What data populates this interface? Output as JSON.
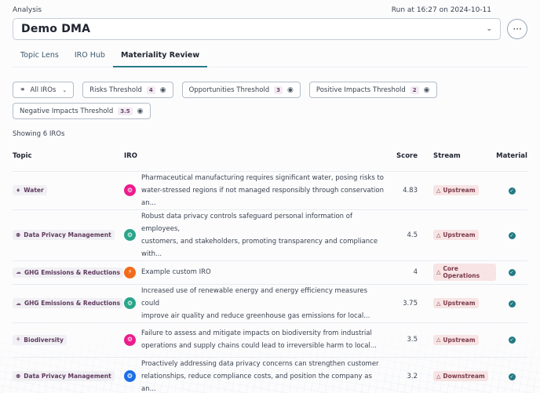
{
  "header": {
    "analysis_label": "Analysis",
    "run_at": "Run at 16:27 on 2024-10-11",
    "analysis_value": "Demo DMA",
    "more_icon": "ellipsis-icon"
  },
  "tabs": [
    {
      "label": "Topic Lens",
      "active": false
    },
    {
      "label": "IRO Hub",
      "active": false
    },
    {
      "label": "Materiality Review",
      "active": true
    }
  ],
  "filters": {
    "all_iros": {
      "label": "All IROs",
      "icon": "link-filter-icon"
    },
    "thresholds": [
      {
        "label": "Risks Threshold",
        "value": "4"
      },
      {
        "label": "Opportunities Threshold",
        "value": "3"
      },
      {
        "label": "Positive Impacts Threshold",
        "value": "2"
      },
      {
        "label": "Negative Impacts Threshold",
        "value": "3.5"
      }
    ]
  },
  "showing": "Showing 6 IROs",
  "table": {
    "columns": [
      "Topic",
      "IRO",
      "Score",
      "Stream",
      "Material"
    ],
    "rows": [
      {
        "topic": "Water",
        "topic_icon": "droplet-icon",
        "iro_type": "negative-impact",
        "iro_color": "#ec1c8c",
        "iro_line1": "Pharmaceutical manufacturing requires significant water, posing risks to",
        "iro_line2": "water-stressed regions if not managed responsibly through conservation an...",
        "score": "4.83",
        "stream": "Upstream",
        "material": true
      },
      {
        "topic": "Data Privacy Management",
        "topic_icon": "lightbulb-icon",
        "iro_type": "positive-impact",
        "iro_color": "#2aa58a",
        "iro_line1": "Robust data privacy controls safeguard personal information of employees,",
        "iro_line2": "customers, and stakeholders, promoting transparency and compliance with...",
        "score": "4.5",
        "stream": "Upstream",
        "material": true
      },
      {
        "topic": "GHG Emissions & Reductions",
        "topic_icon": "cloud-icon",
        "iro_type": "risk",
        "iro_color": "#f26a1b",
        "iro_line1": "Example custom IRO",
        "iro_line2": "",
        "score": "4",
        "stream": "Core Operations",
        "material": true
      },
      {
        "topic": "GHG Emissions & Reductions",
        "topic_icon": "cloud-icon",
        "iro_type": "positive-impact",
        "iro_color": "#2aa58a",
        "iro_line1": "Increased use of renewable energy and energy efficiency measures could",
        "iro_line2": "improve air quality and reduce greenhouse gas emissions for local...",
        "score": "3.75",
        "stream": "Upstream",
        "material": true
      },
      {
        "topic": "Biodiversity",
        "topic_icon": "globe-icon",
        "iro_type": "negative-impact",
        "iro_color": "#ec1c8c",
        "iro_line1": "Failure to assess and mitigate impacts on biodiversity from industrial",
        "iro_line2": "operations and supply chains could lead to irreversible harm to local...",
        "score": "3.5",
        "stream": "Upstream",
        "material": true
      },
      {
        "topic": "Data Privacy Management",
        "topic_icon": "lightbulb-icon",
        "iro_type": "opportunity",
        "iro_color": "#1b6fe8",
        "iro_line1": "Proactively addressing data privacy concerns can strengthen customer",
        "iro_line2": "relationships, reduce compliance costs, and position the company as an...",
        "score": "3.2",
        "stream": "Downstream",
        "material": true
      }
    ]
  }
}
